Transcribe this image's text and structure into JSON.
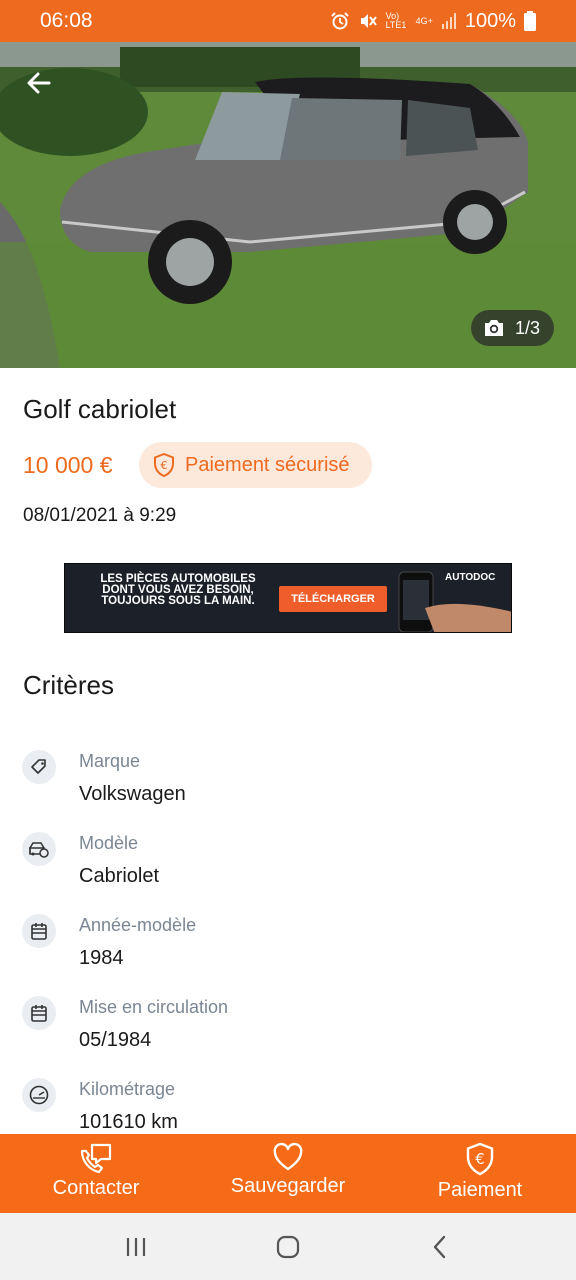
{
  "status_bar": {
    "time": "06:08",
    "network": "Vo) LTE1",
    "signal": "4G+",
    "battery": "100%"
  },
  "hero": {
    "photo_counter": "1/3",
    "icons": {
      "back": "arrow-left-icon",
      "camera": "camera-icon"
    }
  },
  "listing": {
    "title": "Golf cabriolet",
    "price": "10 000 €",
    "secure_payment_label": "Paiement sécurisé",
    "date": "08/01/2021 à 9:29"
  },
  "ad": {
    "text": "LES PIÈCES AUTOMOBILES DONT VOUS AVEZ BESOIN, TOUJOURS SOUS LA MAIN.",
    "cta": "TÉLÉCHARGER",
    "brand": "AUTODOC"
  },
  "criteria": {
    "title": "Critères",
    "items": [
      {
        "label": "Marque",
        "value": "Volkswagen",
        "icon": "tag-icon"
      },
      {
        "label": "Modèle",
        "value": "Cabriolet",
        "icon": "car-model-icon"
      },
      {
        "label": "Année-modèle",
        "value": "1984",
        "icon": "calendar-icon"
      },
      {
        "label": "Mise en circulation",
        "value": "05/1984",
        "icon": "calendar-icon"
      },
      {
        "label": "Kilométrage",
        "value": "101610 km",
        "icon": "speedometer-icon"
      }
    ]
  },
  "actions": {
    "contact": "Contacter",
    "save": "Sauvegarder",
    "payment": "Paiement"
  },
  "colors": {
    "accent": "#ee6a1e",
    "action_bar": "#f56b17",
    "badge_bg": "#fde8dc",
    "label_grey": "#7a8693"
  }
}
